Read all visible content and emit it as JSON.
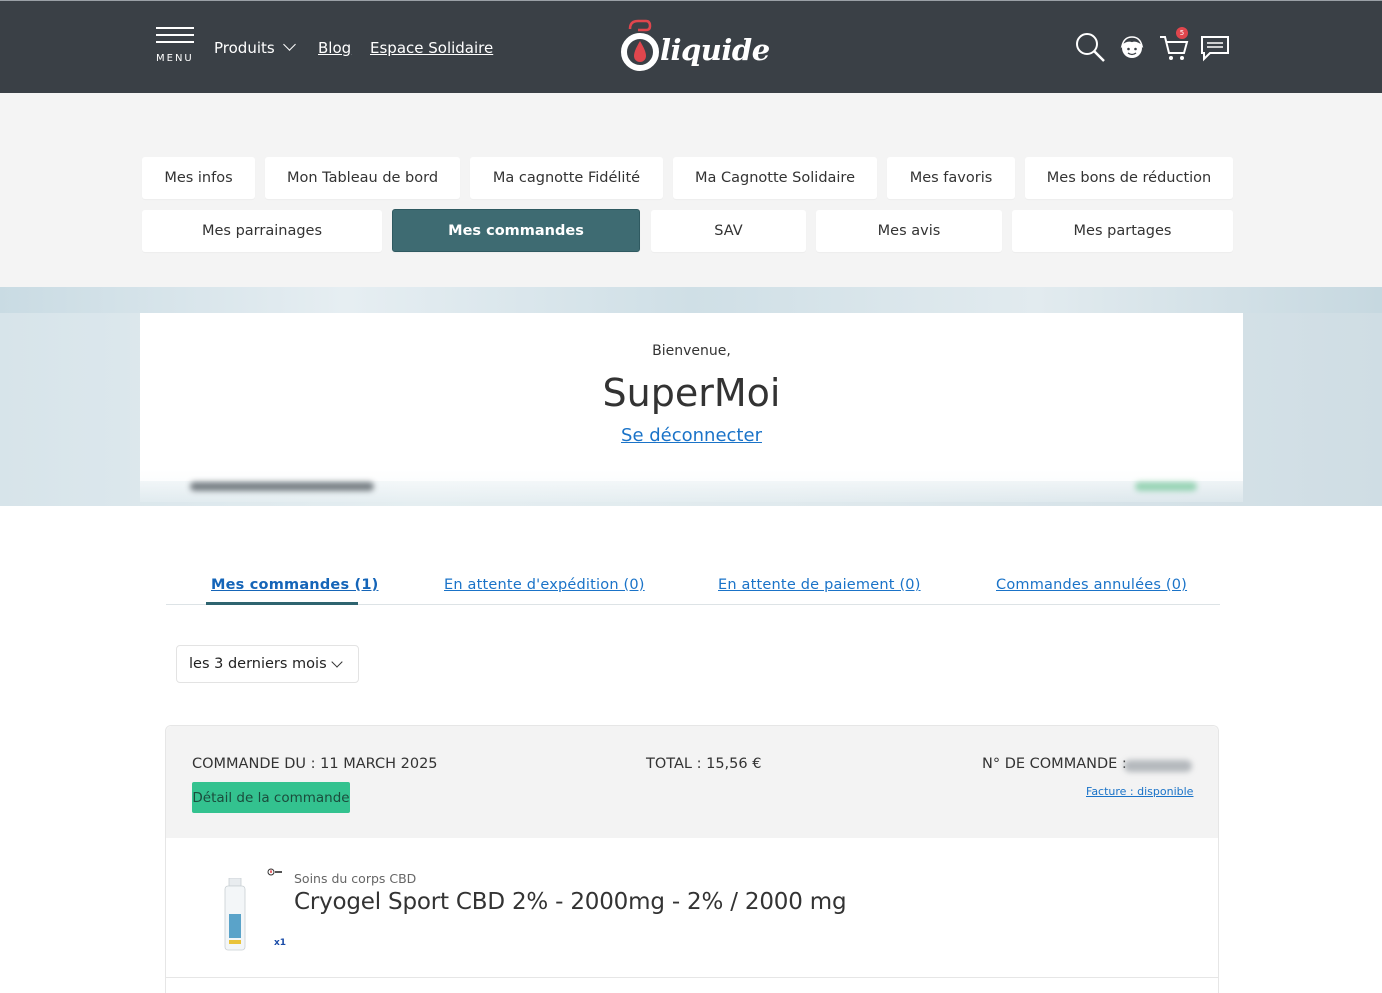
{
  "header": {
    "menu_label": "MENU",
    "nav": {
      "produits": "Produits",
      "blog": "Blog",
      "espace": "Espace Solidaire"
    },
    "logo_text": "liquide",
    "cart_count": "5",
    "icons": [
      "search-icon",
      "account-icon",
      "cart-icon",
      "chat-icon"
    ]
  },
  "account_tabs": {
    "row1": [
      "Mes infos",
      "Mon Tableau de bord",
      "Ma cagnotte Fidélité",
      "Ma Cagnotte Solidaire",
      "Mes favoris",
      "Mes bons de réduction"
    ],
    "row2": [
      "Mes parrainages",
      "Mes commandes",
      "SAV",
      "Mes avis",
      "Mes partages"
    ],
    "active": "Mes commandes"
  },
  "welcome": {
    "greeting": "Bienvenue,",
    "username": "SuperMoi",
    "logout": "Se déconnecter"
  },
  "order_tabs": [
    {
      "label": "Mes commandes (1)",
      "active": true
    },
    {
      "label": "En attente d'expédition (0)",
      "active": false
    },
    {
      "label": "En attente de paiement (0)",
      "active": false
    },
    {
      "label": "Commandes annulées (0)",
      "active": false
    }
  ],
  "filter": {
    "selected": "les 3 derniers mois"
  },
  "order": {
    "date_label": "COMMANDE DU : 11 MARCH 2025",
    "total_label": "TOTAL : 15,56 €",
    "number_label": "N° DE COMMANDE :",
    "detail_button": "Détail de la commande",
    "invoice_link": "Facture : disponible",
    "product": {
      "category": "Soins du corps CBD",
      "name": "Cryogel Sport CBD 2% - 2000mg - 2% / 2000 mg",
      "quantity": "x1"
    }
  },
  "colors": {
    "header_bg": "#3a4046",
    "active_tab": "#3e6b72",
    "link": "#1a73c8",
    "detail_btn": "#33c28f",
    "badge": "#e0464d"
  }
}
